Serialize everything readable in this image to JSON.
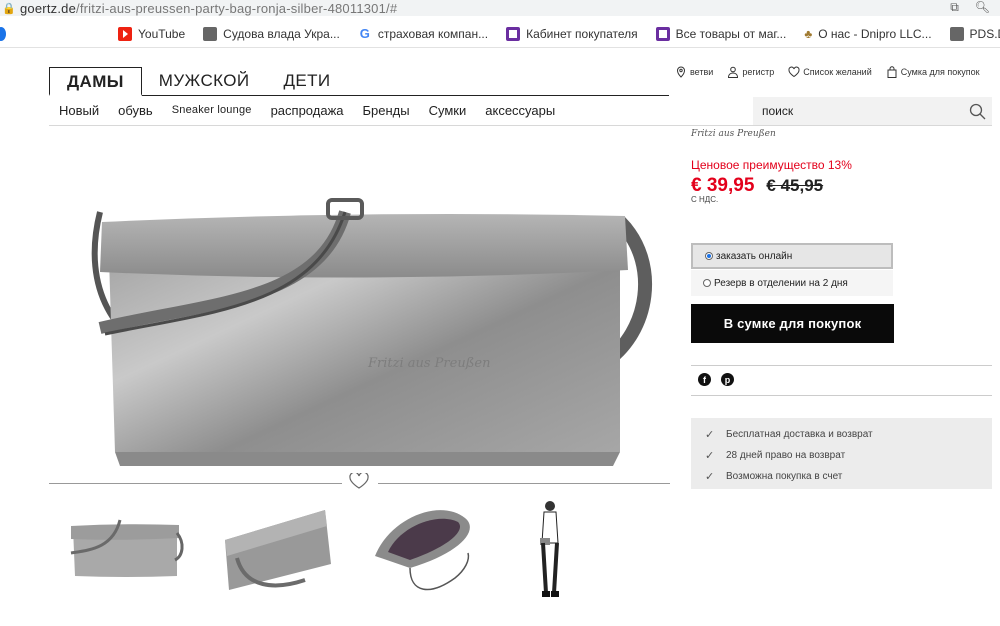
{
  "browser": {
    "url_host": "goertz.de",
    "url_path": "/fritzi-aus-preussen-party-bag-ronja-silber-48011301/#"
  },
  "bookmarks": [
    {
      "label": "YouTube",
      "icon": "youtube-icon"
    },
    {
      "label": "Судова влада Укра...",
      "icon": "globe-icon"
    },
    {
      "label": "страховая компан...",
      "icon": "google-icon"
    },
    {
      "label": "Кабинет покупателя",
      "icon": "square-icon"
    },
    {
      "label": "Все товары от маг...",
      "icon": "square-icon"
    },
    {
      "label": "О нас - Dnipro LLC...",
      "icon": "shell-icon"
    },
    {
      "label": "PDS.Delivery",
      "icon": "globe-icon"
    }
  ],
  "nav": {
    "tabs": [
      "ДАМЫ",
      "МУЖСКОЙ",
      "ДЕТИ"
    ],
    "util": {
      "branches": "ветви",
      "register": "регистр",
      "wishlist": "Список желаний",
      "cart": "Сумка для покупок"
    },
    "categories": [
      "Новый",
      "обувь",
      "Sneaker lounge",
      "распродажа",
      "Бренды",
      "Сумки",
      "аксессуары"
    ],
    "search_placeholder": "поиск"
  },
  "product": {
    "brand_logo": "Fritzi aus Preußen",
    "price_advantage": "Ценовое преимущество 13%",
    "price": "€ 39,95",
    "old_price": "€ 45,95",
    "vat": "С НДС.",
    "options": [
      "заказать онлайн",
      "Резерв в отделении на 2 дня"
    ],
    "selected_option": 0,
    "add_to_cart": "В сумке для покупок",
    "perks": [
      "Бесплатная доставка и возврат",
      "28 дней право на возврат",
      "Возможна покупка в счет"
    ]
  },
  "colors": {
    "accent_red": "#e3001b",
    "cta_black": "#0a0a0a"
  }
}
